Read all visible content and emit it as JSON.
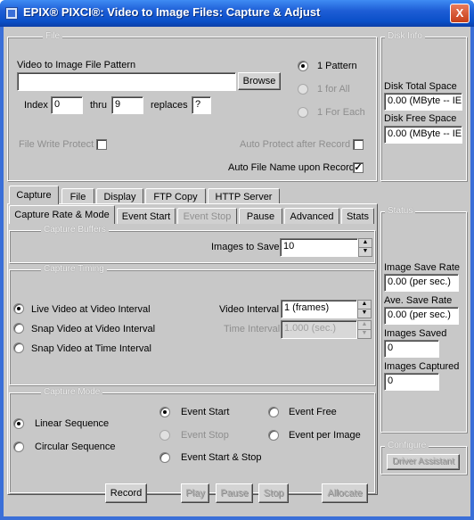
{
  "window": {
    "title": "EPIX® PIXCI®: Video to Image Files: Capture & Adjust",
    "close_glyph": "X"
  },
  "file_group": {
    "legend": "File",
    "pattern_label": "Video to Image File Pattern",
    "pattern_value": "",
    "browse_label": "Browse",
    "index_label": "Index",
    "index_value": "0",
    "thru_label": "thru",
    "thru_value": "9",
    "replaces_label": "replaces",
    "replaces_value": "?",
    "radio_1_pattern": "1 Pattern",
    "radio_1_for_all": "1 for All",
    "radio_1_for_each": "1 For Each",
    "write_protect_label": "File Write Protect",
    "auto_protect_label": "Auto Protect after Record",
    "auto_name_label": "Auto File Name upon Record",
    "auto_name_checked": "✓"
  },
  "disk_info": {
    "legend": "Disk Info",
    "total_label": "Disk Total Space",
    "total_value": "0.00 (MByte -- IE",
    "free_label": "Disk Free Space",
    "free_value": "0.00 (MByte -- IE"
  },
  "main_tabs": [
    "Capture",
    "File",
    "Display",
    "FTP Copy",
    "HTTP Server"
  ],
  "sub_tabs": [
    "Capture Rate & Mode",
    "Event Start",
    "Event Stop",
    "Pause",
    "Advanced",
    "Stats"
  ],
  "capture_buffers": {
    "legend": "Capture Buffers",
    "images_label": "Images to Save",
    "images_value": "10"
  },
  "capture_timing": {
    "legend": "Capture Timing",
    "live_label": "Live Video at Video Interval",
    "snap_video_label": "Snap Video at Video Interval",
    "snap_time_label": "Snap Video at Time Interval",
    "video_interval_label": "Video Interval",
    "video_interval_value": "1 (frames)",
    "time_interval_label": "Time Interval",
    "time_interval_value": "1.000 (sec.)"
  },
  "capture_mode": {
    "legend": "Capture Mode",
    "linear_label": "Linear Sequence",
    "circular_label": "Circular Sequence",
    "event_start_label": "Event Start",
    "event_stop_label": "Event Stop",
    "event_start_stop_label": "Event Start & Stop",
    "event_free_label": "Event Free",
    "event_per_image_label": "Event per Image"
  },
  "status": {
    "legend": "Status",
    "save_rate_label": "Image Save Rate",
    "save_rate_value": "0.00 (per sec.)",
    "ave_rate_label": "Ave. Save Rate",
    "ave_rate_value": "0.00 (per sec.)",
    "saved_label": "Images Saved",
    "saved_value": "0",
    "captured_label": "Images Captured",
    "captured_value": "0"
  },
  "configure": {
    "legend": "Configure",
    "driver_assistant_label": "Driver Assistant"
  },
  "footer": {
    "record_label": "Record",
    "play_label": "Play",
    "pause_label": "Pause",
    "stop_label": "Stop",
    "allocate_label": "Allocate"
  },
  "spin_up_glyph": "▲",
  "spin_down_glyph": "▼"
}
